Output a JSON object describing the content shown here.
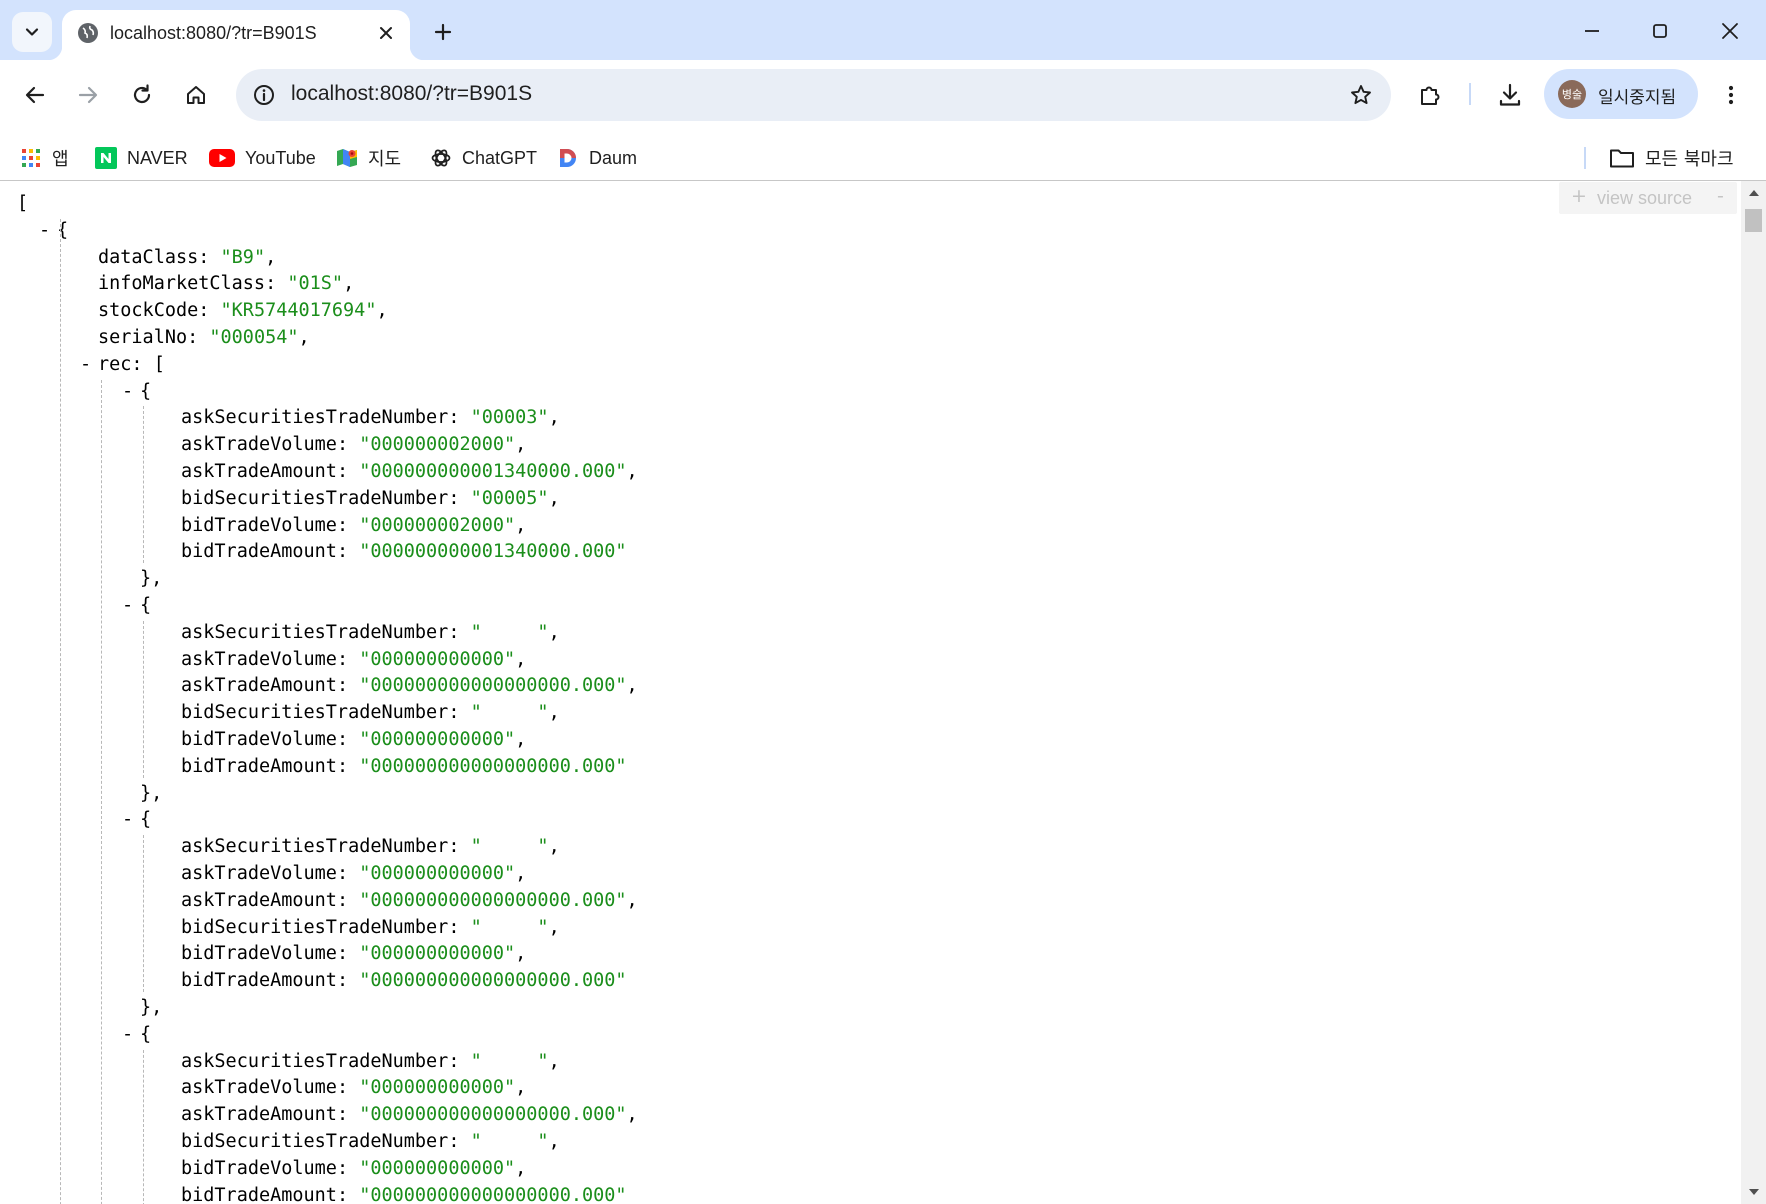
{
  "window": {
    "tab_title": "localhost:8080/?tr=B901S",
    "favicon": "globe-icon",
    "close_tab_icon": "close-icon",
    "new_tab_icon": "plus-icon",
    "controls": [
      "minimize-icon",
      "maximize-icon",
      "close-icon"
    ]
  },
  "toolbar": {
    "url": "localhost:8080/?tr=B901S",
    "icons": [
      "back-icon",
      "forward-icon",
      "reload-icon",
      "home-icon",
      "info-icon",
      "star-icon",
      "extensions-icon",
      "download-icon",
      "more-vert-icon"
    ],
    "profile": {
      "avatar_text": "병술",
      "label": "일시중지됨"
    }
  },
  "bookmarks": {
    "items": [
      {
        "label": "앱",
        "icon": "apps-grid-icon"
      },
      {
        "label": "NAVER",
        "icon": "naver-icon"
      },
      {
        "label": "YouTube",
        "icon": "youtube-icon"
      },
      {
        "label": "지도",
        "icon": "maps-icon"
      },
      {
        "label": "ChatGPT",
        "icon": "chatgpt-icon"
      },
      {
        "label": "Daum",
        "icon": "daum-icon"
      }
    ],
    "all_bookmarks": {
      "label": "모든 북마크",
      "icon": "folder-icon"
    }
  },
  "viewer": {
    "view_source": {
      "expand": "+",
      "label": "view source",
      "collapse": "-"
    },
    "lines": [
      {
        "indent": 0,
        "toggle": "",
        "prefix": "[",
        "key": "",
        "value": "",
        "suffix": ""
      },
      {
        "indent": 1,
        "toggle": "-",
        "prefix": "{",
        "key": "",
        "value": "",
        "suffix": ""
      },
      {
        "indent": 2,
        "toggle": "",
        "prefix": "",
        "key": "dataClass",
        "value": "\"B9\"",
        "suffix": ","
      },
      {
        "indent": 2,
        "toggle": "",
        "prefix": "",
        "key": "infoMarketClass",
        "value": "\"01S\"",
        "suffix": ","
      },
      {
        "indent": 2,
        "toggle": "",
        "prefix": "",
        "key": "stockCode",
        "value": "\"KR5744017694\"",
        "suffix": ","
      },
      {
        "indent": 2,
        "toggle": "",
        "prefix": "",
        "key": "serialNo",
        "value": "\"000054\"",
        "suffix": ","
      },
      {
        "indent": 2,
        "toggle": "-",
        "prefix": "",
        "key": "rec",
        "value": "",
        "suffix": "["
      },
      {
        "indent": 3,
        "toggle": "-",
        "prefix": "{",
        "key": "",
        "value": "",
        "suffix": ""
      },
      {
        "indent": 4,
        "toggle": "",
        "prefix": "",
        "key": "askSecuritiesTradeNumber",
        "value": "\"00003\"",
        "suffix": ","
      },
      {
        "indent": 4,
        "toggle": "",
        "prefix": "",
        "key": "askTradeVolume",
        "value": "\"000000002000\"",
        "suffix": ","
      },
      {
        "indent": 4,
        "toggle": "",
        "prefix": "",
        "key": "askTradeAmount",
        "value": "\"000000000001340000.000\"",
        "suffix": ","
      },
      {
        "indent": 4,
        "toggle": "",
        "prefix": "",
        "key": "bidSecuritiesTradeNumber",
        "value": "\"00005\"",
        "suffix": ","
      },
      {
        "indent": 4,
        "toggle": "",
        "prefix": "",
        "key": "bidTradeVolume",
        "value": "\"000000002000\"",
        "suffix": ","
      },
      {
        "indent": 4,
        "toggle": "",
        "prefix": "",
        "key": "bidTradeAmount",
        "value": "\"000000000001340000.000\"",
        "suffix": ""
      },
      {
        "indent": 3,
        "toggle": "",
        "prefix": "},",
        "key": "",
        "value": "",
        "suffix": ""
      },
      {
        "indent": 3,
        "toggle": "-",
        "prefix": "{",
        "key": "",
        "value": "",
        "suffix": ""
      },
      {
        "indent": 4,
        "toggle": "",
        "prefix": "",
        "key": "askSecuritiesTradeNumber",
        "value": "\"     \"",
        "suffix": ","
      },
      {
        "indent": 4,
        "toggle": "",
        "prefix": "",
        "key": "askTradeVolume",
        "value": "\"000000000000\"",
        "suffix": ","
      },
      {
        "indent": 4,
        "toggle": "",
        "prefix": "",
        "key": "askTradeAmount",
        "value": "\"000000000000000000.000\"",
        "suffix": ","
      },
      {
        "indent": 4,
        "toggle": "",
        "prefix": "",
        "key": "bidSecuritiesTradeNumber",
        "value": "\"     \"",
        "suffix": ","
      },
      {
        "indent": 4,
        "toggle": "",
        "prefix": "",
        "key": "bidTradeVolume",
        "value": "\"000000000000\"",
        "suffix": ","
      },
      {
        "indent": 4,
        "toggle": "",
        "prefix": "",
        "key": "bidTradeAmount",
        "value": "\"000000000000000000.000\"",
        "suffix": ""
      },
      {
        "indent": 3,
        "toggle": "",
        "prefix": "},",
        "key": "",
        "value": "",
        "suffix": ""
      },
      {
        "indent": 3,
        "toggle": "-",
        "prefix": "{",
        "key": "",
        "value": "",
        "suffix": ""
      },
      {
        "indent": 4,
        "toggle": "",
        "prefix": "",
        "key": "askSecuritiesTradeNumber",
        "value": "\"     \"",
        "suffix": ","
      },
      {
        "indent": 4,
        "toggle": "",
        "prefix": "",
        "key": "askTradeVolume",
        "value": "\"000000000000\"",
        "suffix": ","
      },
      {
        "indent": 4,
        "toggle": "",
        "prefix": "",
        "key": "askTradeAmount",
        "value": "\"000000000000000000.000\"",
        "suffix": ","
      },
      {
        "indent": 4,
        "toggle": "",
        "prefix": "",
        "key": "bidSecuritiesTradeNumber",
        "value": "\"     \"",
        "suffix": ","
      },
      {
        "indent": 4,
        "toggle": "",
        "prefix": "",
        "key": "bidTradeVolume",
        "value": "\"000000000000\"",
        "suffix": ","
      },
      {
        "indent": 4,
        "toggle": "",
        "prefix": "",
        "key": "bidTradeAmount",
        "value": "\"000000000000000000.000\"",
        "suffix": ""
      },
      {
        "indent": 3,
        "toggle": "",
        "prefix": "},",
        "key": "",
        "value": "",
        "suffix": ""
      },
      {
        "indent": 3,
        "toggle": "-",
        "prefix": "{",
        "key": "",
        "value": "",
        "suffix": ""
      },
      {
        "indent": 4,
        "toggle": "",
        "prefix": "",
        "key": "askSecuritiesTradeNumber",
        "value": "\"     \"",
        "suffix": ","
      },
      {
        "indent": 4,
        "toggle": "",
        "prefix": "",
        "key": "askTradeVolume",
        "value": "\"000000000000\"",
        "suffix": ","
      },
      {
        "indent": 4,
        "toggle": "",
        "prefix": "",
        "key": "askTradeAmount",
        "value": "\"000000000000000000.000\"",
        "suffix": ","
      },
      {
        "indent": 4,
        "toggle": "",
        "prefix": "",
        "key": "bidSecuritiesTradeNumber",
        "value": "\"     \"",
        "suffix": ","
      },
      {
        "indent": 4,
        "toggle": "",
        "prefix": "",
        "key": "bidTradeVolume",
        "value": "\"000000000000\"",
        "suffix": ","
      },
      {
        "indent": 4,
        "toggle": "",
        "prefix": "",
        "key": "bidTradeAmount",
        "value": "\"000000000000000000.000\"",
        "suffix": ""
      },
      {
        "indent": 3,
        "toggle": "",
        "prefix": "},",
        "key": "",
        "value": "",
        "suffix": ""
      }
    ]
  }
}
